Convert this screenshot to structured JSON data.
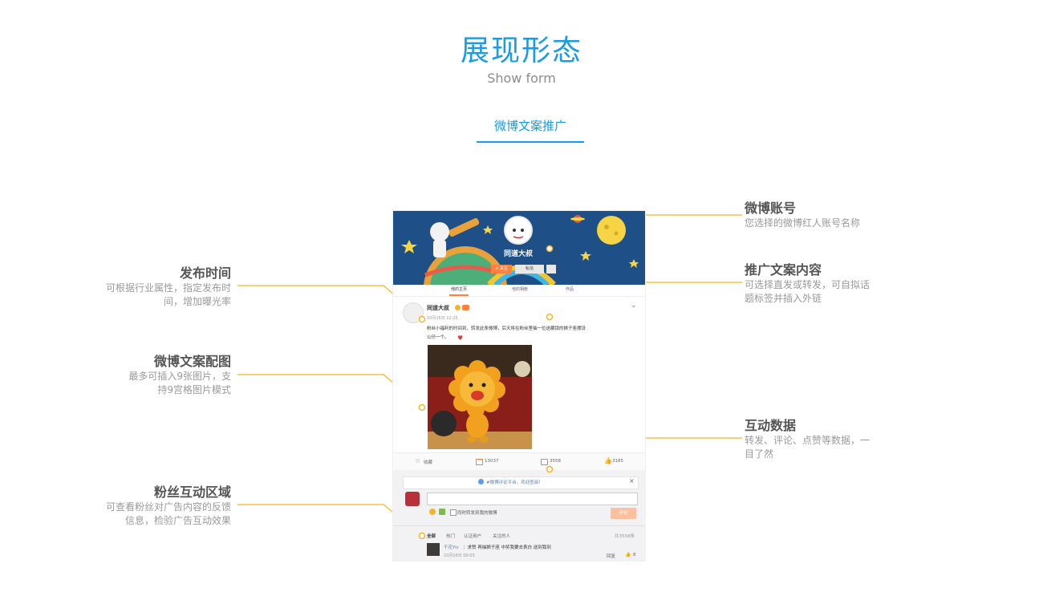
{
  "header": {
    "title": "展现形态",
    "subtitle": "Show form",
    "tab_label": "微博文案推广"
  },
  "annotations": {
    "account": {
      "title": "微博账号",
      "desc": "您选择的微博红人账号名称"
    },
    "publish_time": {
      "title": "发布时间",
      "desc_line1": "可根据行业属性，指定发布时",
      "desc_line2": "间，增加曝光率"
    },
    "content": {
      "title": "推广文案内容",
      "desc_line1": "可选择直发或转发，可自拟话",
      "desc_line2": "题标签并插入外链"
    },
    "images": {
      "title": "微博文案配图",
      "desc_line1": "最多可插入9张图片，支",
      "desc_line2": "持9宫格图片模式"
    },
    "interaction": {
      "title": "互动数据",
      "desc_line1": "转发、评论、点赞等数据，一",
      "desc_line2": "目了然"
    },
    "fans": {
      "title": "粉丝互动区域",
      "desc_line1": "可查看粉丝对广告内容的反馈",
      "desc_line2": "信息，检验广告互动效果"
    }
  },
  "weibo": {
    "profile_name": "同道大叔",
    "follow_button": "+ 关注",
    "message_button": "私信",
    "profile_tabs": [
      "他的主页",
      "他的相册",
      "作品"
    ],
    "post": {
      "author": "同道大叔",
      "time": "10月15日 22:25",
      "text_line1": "粉丝小福利的时间到，转发此条微博，后天将在粉丝里抽一位送藏锁的狮子座摆设",
      "text_line2": "公仔一个。"
    },
    "actions": {
      "collect": "收藏",
      "repost": "13037",
      "comment": "3558",
      "like": "3185"
    },
    "comment_box": {
      "notice": "#微博评论平台，欢迎查阅！",
      "close": "×",
      "checkbox_label": "同时转发到我的微博",
      "submit": "评论"
    },
    "filters": [
      "全部",
      "热门",
      "认证用户",
      "关注的人"
    ],
    "total": "共3558条",
    "comment": {
      "user": "千花Yiz",
      "text": "：求赞 再抽狮子座 中奖我要去表白 送到我到",
      "time": "10月16日 00:03",
      "reply": "回复",
      "likes": "8"
    }
  },
  "colors": {
    "title_blue": "#1a9be6",
    "callout_orange": "#f5b326",
    "banner_navy": "#1e4f86",
    "button_orange": "#ff8140"
  }
}
